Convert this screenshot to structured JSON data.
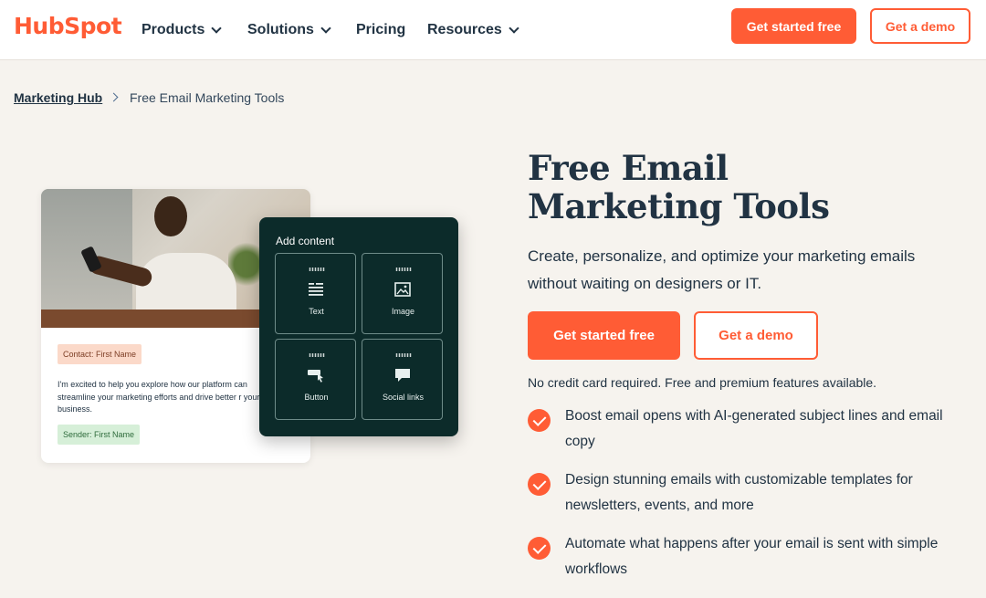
{
  "header": {
    "logo": "HubSpot",
    "nav": [
      {
        "label": "Products",
        "has_dropdown": true
      },
      {
        "label": "Solutions",
        "has_dropdown": true
      },
      {
        "label": "Pricing",
        "has_dropdown": false
      },
      {
        "label": "Resources",
        "has_dropdown": true
      }
    ],
    "cta_primary": "Get started free",
    "cta_secondary": "Get a demo"
  },
  "breadcrumb": {
    "parent": "Marketing Hub",
    "current": "Free Email Marketing Tools"
  },
  "illustration": {
    "contact_tag": "Contact: First Name",
    "email_body": "I'm excited to help you explore how our platform can streamline your marketing efforts and drive better r your business.",
    "sender_tag": "Sender: First Name",
    "panel_title": "Add content",
    "tiles": [
      {
        "label": "Text",
        "icon": "text-align-icon"
      },
      {
        "label": "Image",
        "icon": "image-icon"
      },
      {
        "label": "Button",
        "icon": "button-cursor-icon"
      },
      {
        "label": "Social links",
        "icon": "chat-bubble-icon"
      }
    ]
  },
  "hero": {
    "title": "Free Email Marketing Tools",
    "subtitle": "Create, personalize, and optimize your marketing emails without waiting on designers or IT.",
    "cta_primary": "Get started free",
    "cta_secondary": "Get a demo",
    "note": "No credit card required. Free and premium features available.",
    "features": [
      "Boost email opens with AI-generated subject lines and email copy",
      "Design stunning emails with customizable templates for newsletters, events, and more",
      "Automate what happens after your email is sent with simple workflows"
    ]
  },
  "colors": {
    "brand": "#ff5c35",
    "text": "#213343",
    "background": "#f6f3ee",
    "panel": "#0c2b2a"
  }
}
